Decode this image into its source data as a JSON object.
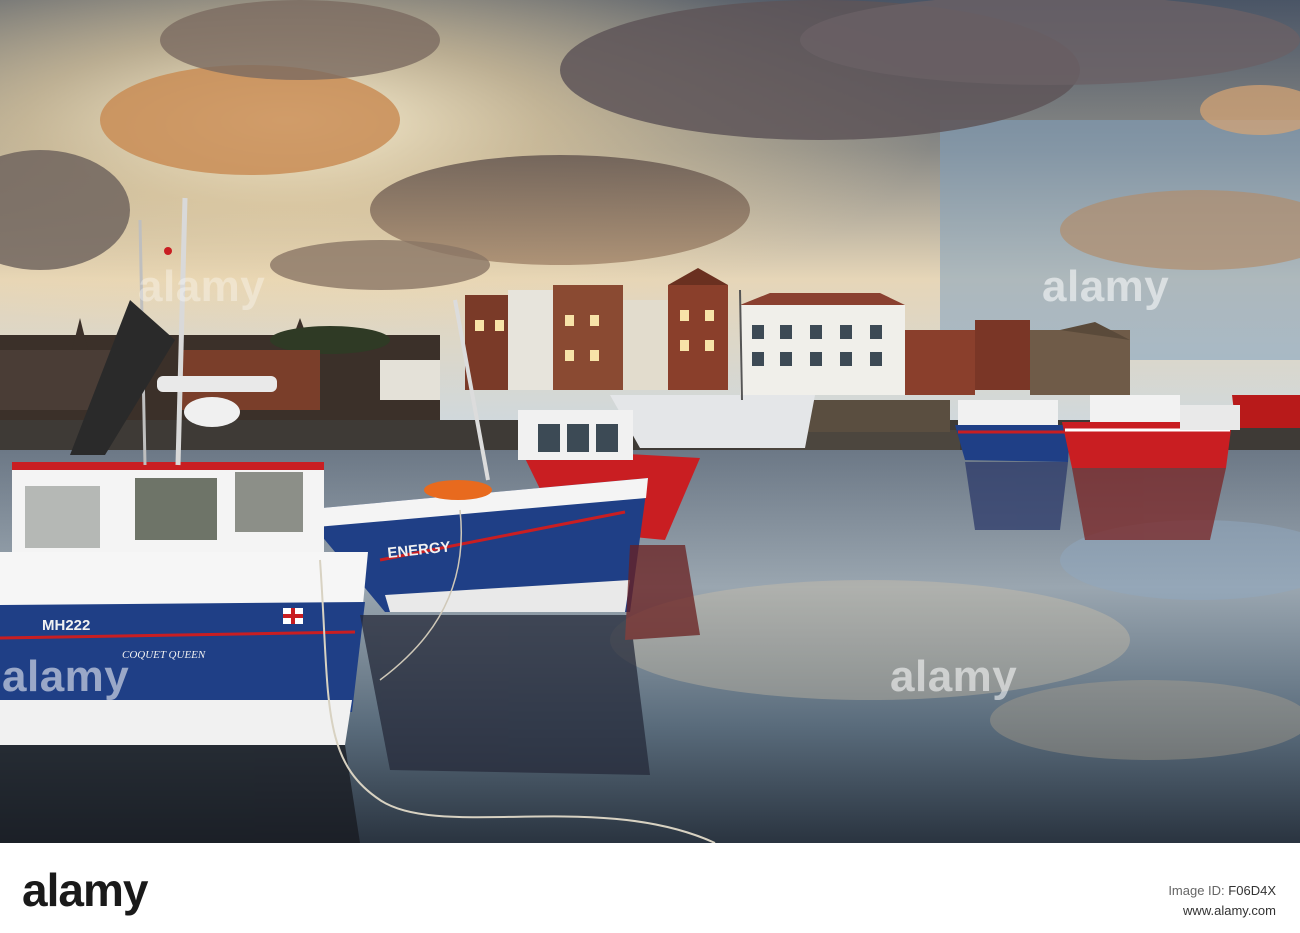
{
  "photo": {
    "boat_registration": "MH222",
    "boat_name_left": "COQUET QUEEN",
    "boat_name_center": "ENERGY"
  },
  "watermark": {
    "text": "alamy"
  },
  "footer": {
    "logo": "alamy",
    "image_id_label": "Image ID:",
    "image_id": "F06D4X",
    "url": "www.alamy.com"
  },
  "colors": {
    "sky_top": "#3a4a5e",
    "sky_glow": "#f6d9a4",
    "water": "#5c6d7d",
    "hull_blue": "#1f3f86",
    "hull_red": "#c91e22",
    "footer_bg": "#ffffff"
  }
}
